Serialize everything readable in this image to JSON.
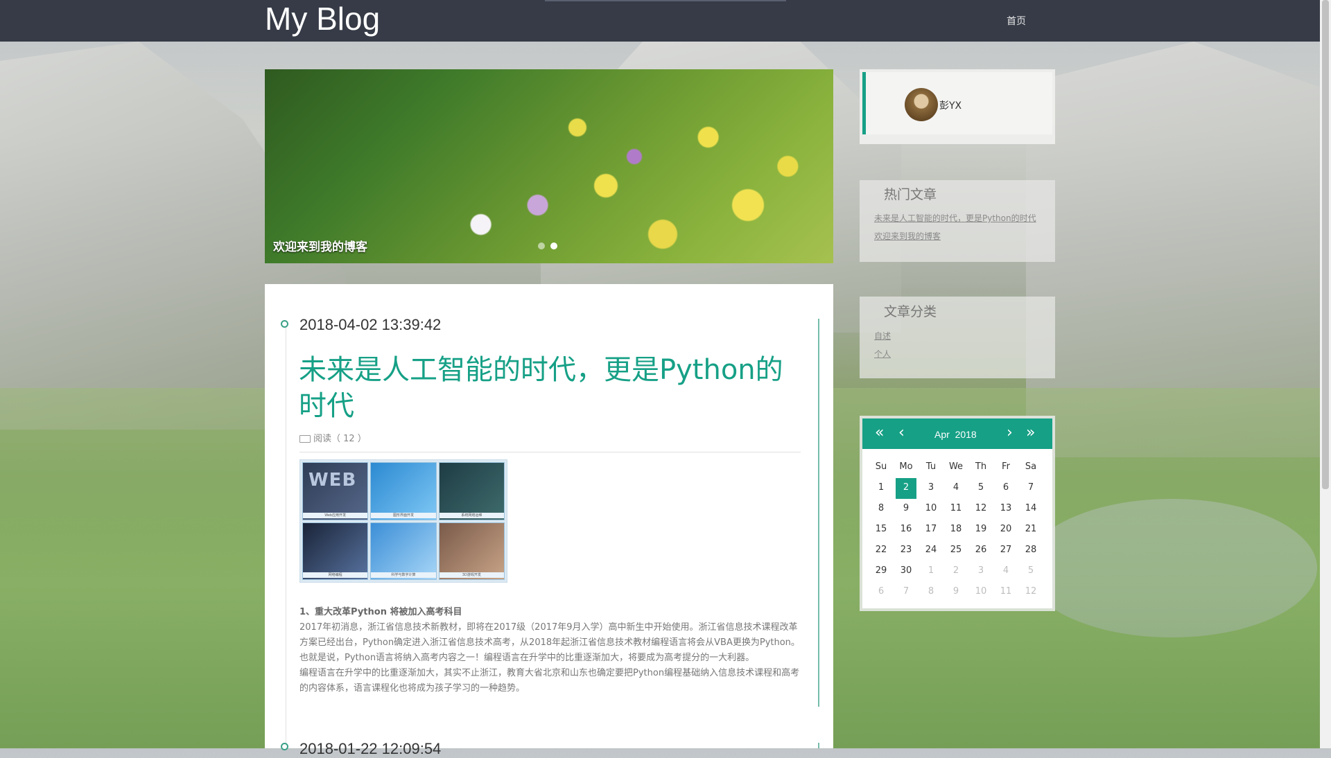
{
  "navbar": {
    "brand": "My Blog",
    "home_link": "首页"
  },
  "banner": {
    "caption": "欢迎来到我的博客",
    "slides": 2,
    "active_slide": 1
  },
  "post1": {
    "date": "2018-04-02 13:39:42",
    "title": "未来是人工智能的时代，更是Python的时代",
    "meta": "阅读（ 12 ）",
    "thumbs": [
      "Web应用开发",
      "图形界面开发",
      "系统网络运维",
      "网络编程",
      "科学与数字计算",
      "3D游戏开发"
    ],
    "web_word": "WEB",
    "subheading": "1、重大改革Python 将被加入高考科目",
    "paragraph1": "2017年初消息，浙江省信息技术新教材，即将在2017级（2017年9月入学）高中新生中开始使用。浙江省信息技术课程改革方案已经出台，Python确定进入浙江省信息技术高考，从2018年起浙江省信息技术教材编程语言将会从VBA更换为Python。也就是说，Python语言将纳入高考内容之一！编程语言在升学中的比重逐渐加大，将要成为高考提分的一大利器。",
    "paragraph2": "编程语言在升学中的比重逐渐加大，其实不止浙江，教育大省北京和山东也确定要把Python编程基础纳入信息技术课程和高考的内容体系，语言课程化也将成为孩子学习的一种趋势。"
  },
  "post2": {
    "date": "2018-01-22 12:09:54"
  },
  "profile": {
    "name": "彭YX"
  },
  "hot_articles": {
    "title": "热门文章",
    "items": [
      "未来是人工智能的时代，更是Python的时代",
      "欢迎来到我的博客"
    ]
  },
  "categories": {
    "title": "文章分类",
    "items": [
      "自述",
      "个人"
    ]
  },
  "calendar": {
    "month": "Apr",
    "year": "2018",
    "weekdays": [
      "Su",
      "Mo",
      "Tu",
      "We",
      "Th",
      "Fr",
      "Sa"
    ],
    "days": [
      [
        "1",
        "2",
        "3",
        "4",
        "5",
        "6",
        "7"
      ],
      [
        "8",
        "9",
        "10",
        "11",
        "12",
        "13",
        "14"
      ],
      [
        "15",
        "16",
        "17",
        "18",
        "19",
        "20",
        "21"
      ],
      [
        "22",
        "23",
        "24",
        "25",
        "26",
        "27",
        "28"
      ],
      [
        "29",
        "30",
        "1",
        "2",
        "3",
        "4",
        "5"
      ],
      [
        "6",
        "7",
        "8",
        "9",
        "10",
        "11",
        "12"
      ]
    ],
    "selected_day": "2",
    "icons": {
      "prev_year": "double-chevron-left-icon",
      "prev_month": "chevron-left-icon",
      "next_month": "chevron-right-icon",
      "next_year": "double-chevron-right-icon"
    }
  },
  "colors": {
    "accent": "#16a086",
    "navbar": "#363b47"
  }
}
